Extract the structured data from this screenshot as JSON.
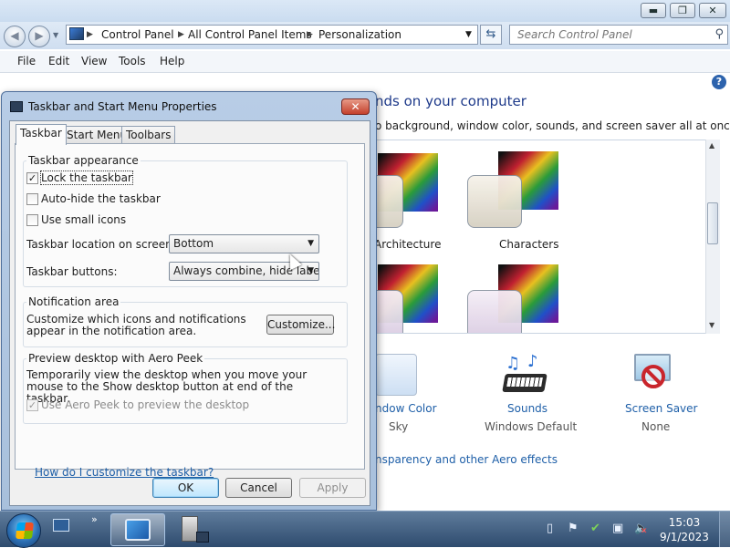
{
  "control_panel": {
    "breadcrumb": [
      "Control Panel",
      "All Control Panel Items",
      "Personalization"
    ],
    "search_placeholder": "Search Control Panel",
    "menu": [
      "File",
      "Edit",
      "View",
      "Tools",
      "Help"
    ],
    "heading": "nds on your computer",
    "subheading": "o background, window color, sounds, and screen saver all at once.",
    "themes": [
      {
        "label": "Architecture"
      },
      {
        "label": "Characters"
      },
      {
        "label": ""
      },
      {
        "label": ""
      }
    ],
    "bottom_items": [
      {
        "label": "ndow Color",
        "value": "Sky",
        "icon": "window-color-icon"
      },
      {
        "label": "Sounds",
        "value": "Windows Default",
        "icon": "sounds-icon"
      },
      {
        "label": "Screen Saver",
        "value": "None",
        "icon": "screen-saver-icon"
      }
    ],
    "transparency_link": "nsparency and other Aero effects"
  },
  "dialog": {
    "title": "Taskbar and Start Menu Properties",
    "close_label": "✕",
    "tabs": [
      "Taskbar",
      "Start Menu",
      "Toolbars"
    ],
    "appearance": {
      "title": "Taskbar appearance",
      "lock_label": "Lock the taskbar",
      "lock_checked": true,
      "autohide_label": "Auto-hide the taskbar",
      "autohide_checked": false,
      "small_icons_label": "Use small icons",
      "small_icons_checked": false,
      "location_label": "Taskbar location on screen:",
      "location_value": "Bottom",
      "buttons_label": "Taskbar buttons:",
      "buttons_value": "Always combine, hide labels"
    },
    "notification": {
      "title": "Notification area",
      "text": "Customize which icons and notifications appear in the notification area.",
      "customize_label": "Customize..."
    },
    "peek": {
      "title": "Preview desktop with Aero Peek",
      "text": "Temporarily view the desktop when you move your mouse to the Show desktop button at end of the taskbar.",
      "checkbox_label": "Use Aero Peek to preview the desktop",
      "checked": true
    },
    "help_link": "How do I customize the taskbar?",
    "ok_label": "OK",
    "cancel_label": "Cancel",
    "apply_label": "Apply"
  },
  "taskbar": {
    "time": "15:03",
    "date": "9/1/2023",
    "colors": {
      "accent": "#2e4b6e"
    }
  }
}
